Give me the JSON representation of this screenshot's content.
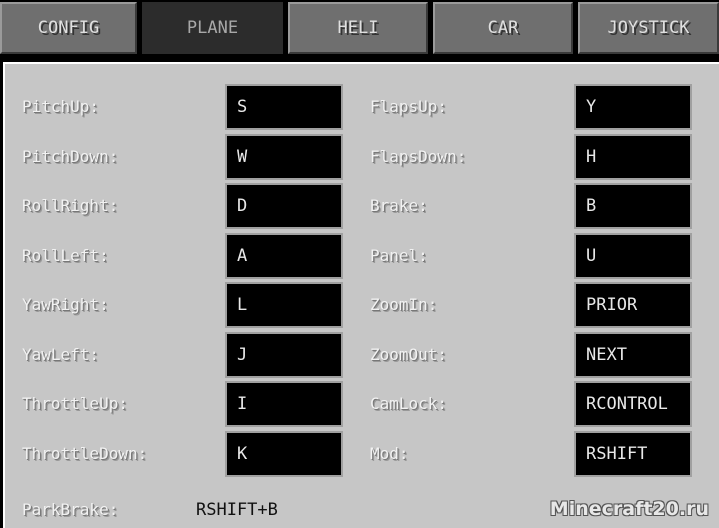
{
  "tabs": [
    {
      "label": "CONFIG"
    },
    {
      "label": "PLANE",
      "active": true
    },
    {
      "label": "HELI"
    },
    {
      "label": "CAR"
    },
    {
      "label": "JOYSTICK"
    }
  ],
  "left": [
    {
      "label": "PitchUp:",
      "key": "S"
    },
    {
      "label": "PitchDown:",
      "key": "W"
    },
    {
      "label": "RollRight:",
      "key": "D"
    },
    {
      "label": "RollLeft:",
      "key": "A"
    },
    {
      "label": "YawRight:",
      "key": "L"
    },
    {
      "label": "YawLeft:",
      "key": "J"
    },
    {
      "label": "ThrottleUp:",
      "key": "I"
    },
    {
      "label": "ThrottleDown:",
      "key": "K"
    }
  ],
  "right": [
    {
      "label": "FlapsUp:",
      "key": "Y"
    },
    {
      "label": "FlapsDown:",
      "key": "H"
    },
    {
      "label": "Brake:",
      "key": "B"
    },
    {
      "label": "Panel:",
      "key": "U"
    },
    {
      "label": "ZoomIn:",
      "key": "PRIOR"
    },
    {
      "label": "ZoomOut:",
      "key": "NEXT"
    },
    {
      "label": "CamLock:",
      "key": "RCONTROL"
    },
    {
      "label": "Mod:",
      "key": "RSHIFT"
    }
  ],
  "park_brake": {
    "label": "ParkBrake:",
    "value": "RSHIFT+B"
  },
  "watermark": "Minecraft20.ru"
}
